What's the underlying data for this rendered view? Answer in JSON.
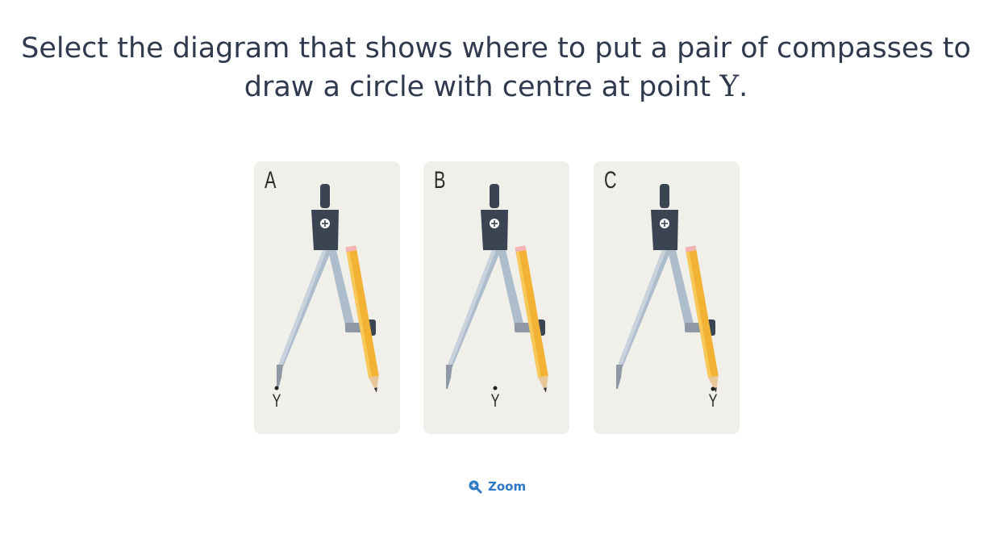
{
  "question": {
    "line1": "Select the diagram that shows where to put a pair of compasses to",
    "line2_prefix": "draw a circle with centre at point ",
    "variable": "Y",
    "line2_suffix": "."
  },
  "options": [
    {
      "letter": "A",
      "point_label": "Y",
      "placement": "needle-on-point"
    },
    {
      "letter": "B",
      "point_label": "Y",
      "placement": "point-between-legs"
    },
    {
      "letter": "C",
      "point_label": "Y",
      "placement": "pencil-on-point"
    }
  ],
  "zoom": {
    "label": "Zoom",
    "icon": "zoom-in-icon"
  },
  "colors": {
    "text": "#2f3a4e",
    "card_bg": "#f1efe9",
    "link": "#2d79c7",
    "compass_head": "#3b4452",
    "pencil": "#f2b233"
  }
}
